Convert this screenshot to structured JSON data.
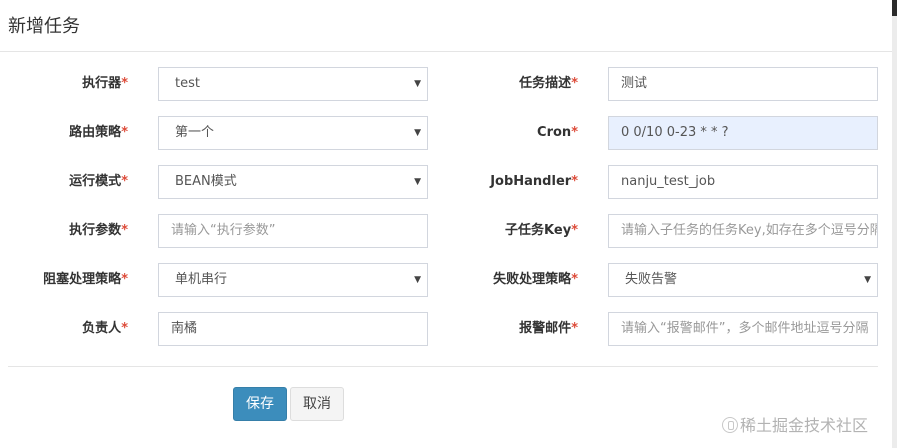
{
  "modal": {
    "title": "新增任务"
  },
  "form": {
    "required_mark": "*",
    "left": [
      {
        "label": "执行器",
        "value": "test",
        "type": "select"
      },
      {
        "label": "路由策略",
        "value": "第一个",
        "type": "select"
      },
      {
        "label": "运行模式",
        "value": "BEAN模式",
        "type": "select"
      },
      {
        "label": "执行参数",
        "placeholder": "请输入“执行参数”",
        "type": "input"
      },
      {
        "label": "阻塞处理策略",
        "value": "单机串行",
        "type": "select"
      },
      {
        "label": "负责人",
        "value": "南橘",
        "type": "input"
      }
    ],
    "right": [
      {
        "label": "任务描述",
        "value": "测试",
        "type": "input"
      },
      {
        "label": "Cron",
        "value": "0 0/10 0-23 * * ?",
        "type": "input"
      },
      {
        "label": "JobHandler",
        "value": "nanju_test_job",
        "type": "input"
      },
      {
        "label": "子任务Key",
        "placeholder": "请输入子任务的任务Key,如存在多个逗号分隔",
        "type": "input"
      },
      {
        "label": "失败处理策略",
        "value": "失败告警",
        "type": "select"
      },
      {
        "label": "报警邮件",
        "placeholder": "请输入“报警邮件”，多个邮件地址逗号分隔",
        "type": "input"
      }
    ]
  },
  "buttons": {
    "save": "保存",
    "cancel": "取消"
  },
  "watermark": "稀土掘金技术社区",
  "icons": {
    "caret": "caret-down-icon"
  },
  "colors": {
    "primary": "#3c8dbc",
    "required": "#dd4b39",
    "highlight": "#e8f0fe"
  }
}
